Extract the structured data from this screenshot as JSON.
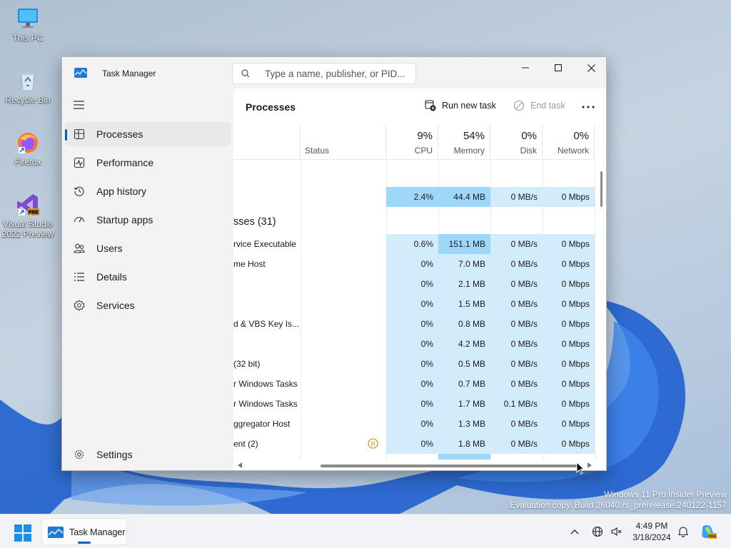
{
  "desktop": {
    "icons": [
      {
        "label": "This PC",
        "icon": "this-pc-icon"
      },
      {
        "label": "Recycle Bin",
        "icon": "recycle-bin-icon"
      },
      {
        "label": "Firefox",
        "icon": "firefox-icon"
      },
      {
        "label": "Visual Studio 2022 Preview",
        "icon": "visual-studio-icon",
        "badge": "PRE"
      }
    ],
    "watermark": {
      "line1": "Windows 11 Pro Insider Preview",
      "line2": "Evaluation copy. Build 26040.rs_prerelease.240122-1157"
    }
  },
  "window": {
    "title": "Task Manager",
    "search_placeholder": "Type a name, publisher, or PID...",
    "controls": {
      "minimize": "minimize-icon",
      "maximize": "maximize-icon",
      "close": "close-icon"
    }
  },
  "sidebar": {
    "items": [
      {
        "label": "Processes",
        "icon": "processes-icon",
        "active": true
      },
      {
        "label": "Performance",
        "icon": "performance-icon"
      },
      {
        "label": "App history",
        "icon": "app-history-icon"
      },
      {
        "label": "Startup apps",
        "icon": "startup-apps-icon"
      },
      {
        "label": "Users",
        "icon": "users-icon"
      },
      {
        "label": "Details",
        "icon": "details-icon"
      },
      {
        "label": "Services",
        "icon": "services-icon"
      }
    ],
    "settings_label": "Settings"
  },
  "main": {
    "title": "Processes",
    "run_new_task": "Run new task",
    "end_task": "End task",
    "columns": {
      "status": {
        "name": "Status"
      },
      "cpu": {
        "pct": "9%",
        "name": "CPU"
      },
      "memory": {
        "pct": "54%",
        "name": "Memory"
      },
      "disk": {
        "pct": "0%",
        "name": "Disk"
      },
      "network": {
        "pct": "0%",
        "name": "Network"
      }
    },
    "apps_summary": {
      "cpu": "2.4%",
      "memory": "44.4 MB",
      "disk": "0 MB/s",
      "network": "0 Mbps"
    },
    "group_label": "sses (31)",
    "rows": [
      {
        "name": "rvice Executable",
        "cpu": "0.6%",
        "memory": "151.1 MB",
        "disk": "0 MB/s",
        "network": "0 Mbps"
      },
      {
        "name": "me Host",
        "cpu": "0%",
        "memory": "7.0 MB",
        "disk": "0 MB/s",
        "network": "0 Mbps"
      },
      {
        "name": "",
        "cpu": "0%",
        "memory": "2.1 MB",
        "disk": "0 MB/s",
        "network": "0 Mbps"
      },
      {
        "name": "",
        "cpu": "0%",
        "memory": "1.5 MB",
        "disk": "0 MB/s",
        "network": "0 Mbps"
      },
      {
        "name": "d & VBS Key Is...",
        "cpu": "0%",
        "memory": "0.8 MB",
        "disk": "0 MB/s",
        "network": "0 Mbps"
      },
      {
        "name": "",
        "cpu": "0%",
        "memory": "4.2 MB",
        "disk": "0 MB/s",
        "network": "0 Mbps"
      },
      {
        "name": "(32 bit)",
        "cpu": "0%",
        "memory": "0.5 MB",
        "disk": "0 MB/s",
        "network": "0 Mbps"
      },
      {
        "name": "r Windows Tasks",
        "cpu": "0%",
        "memory": "0.7 MB",
        "disk": "0 MB/s",
        "network": "0 Mbps"
      },
      {
        "name": "r Windows Tasks",
        "cpu": "0%",
        "memory": "1.7 MB",
        "disk": "0.1 MB/s",
        "network": "0 Mbps"
      },
      {
        "name": "ggregator Host",
        "cpu": "0%",
        "memory": "1.3 MB",
        "disk": "0 MB/s",
        "network": "0 Mbps"
      },
      {
        "name": "ent (2)",
        "cpu": "0%",
        "memory": "1.8 MB",
        "disk": "0 MB/s",
        "network": "0 Mbps",
        "status_icon": "suspended-icon"
      }
    ]
  },
  "taskbar": {
    "app_label": "Task Manager",
    "time": "4:49 PM",
    "date": "3/18/2024"
  },
  "colors": {
    "accent": "#005fb8",
    "heat_light": "#d3ecfc",
    "heat_medium": "#9fd7fa",
    "suspended": "#c88a00"
  }
}
